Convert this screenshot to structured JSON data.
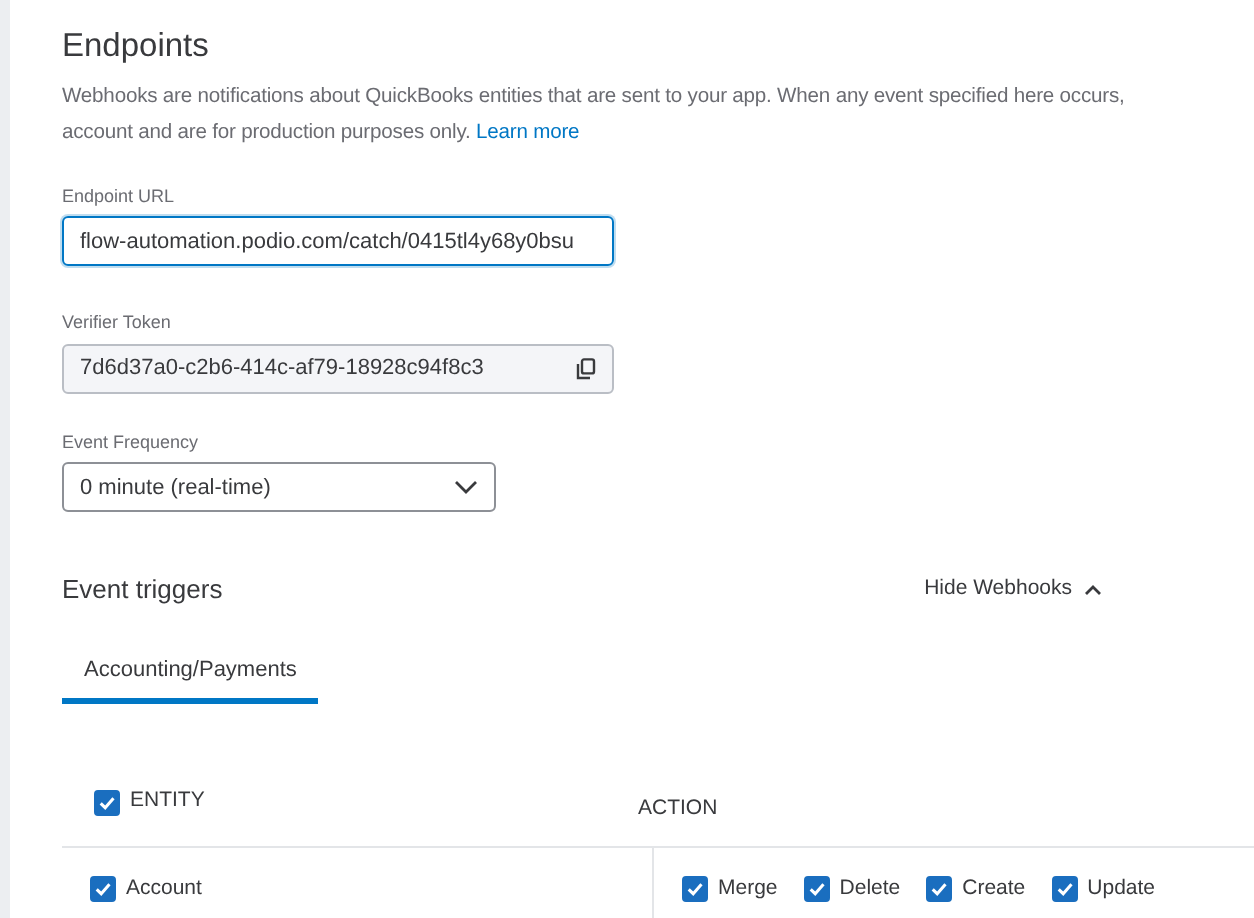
{
  "title": "Endpoints",
  "description": {
    "lines": [
      "Webhooks are notifications about QuickBooks entities that are sent to your app. When any event specified here occurs,",
      "account and are for production purposes only."
    ],
    "link": "Learn more"
  },
  "endpoint_url": {
    "label": "Endpoint URL",
    "value": "flow-automation.podio.com/catch/0415tl4y68y0bsu"
  },
  "verifier_token": {
    "label": "Verifier Token",
    "value": "7d6d37a0-c2b6-414c-af79-18928c94f8c3"
  },
  "event_frequency": {
    "label": "Event Frequency",
    "value": "0 minute (real-time)"
  },
  "event_triggers": {
    "title": "Event triggers",
    "toggle": "Hide Webhooks",
    "tabs": [
      {
        "label": "Accounting/Payments",
        "selected": true
      }
    ],
    "entity_header": {
      "label": "ENTITY",
      "checked": true
    },
    "action_header": "ACTION",
    "rows": [
      {
        "entity": "Account",
        "checked": true,
        "actions": [
          {
            "label": "Merge",
            "checked": true
          },
          {
            "label": "Delete",
            "checked": true
          },
          {
            "label": "Create",
            "checked": true
          },
          {
            "label": "Update",
            "checked": true
          }
        ]
      }
    ]
  }
}
